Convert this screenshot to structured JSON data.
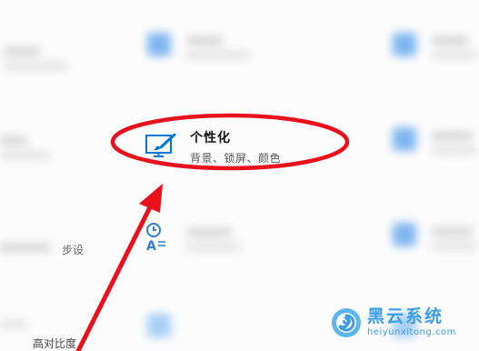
{
  "item": {
    "title": "个性化",
    "subtitle": "背景、锁屏、颜色",
    "icon": "personalization-icon"
  },
  "side_labels": [
    "步设",
    "高对比度"
  ],
  "watermark": {
    "brand_cn": "黑云系统",
    "brand_en": "heiyunxitong.com"
  },
  "colors": {
    "accent": "#0078d7",
    "annotation": "#e8111c",
    "watermark": "#3a9de6"
  }
}
